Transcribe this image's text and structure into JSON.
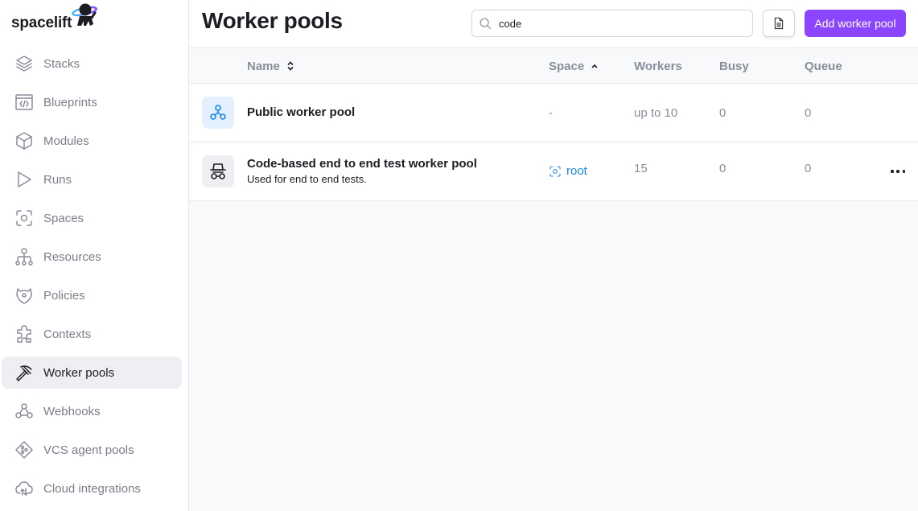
{
  "app": {
    "brand": "spacelift",
    "accent_color": "#8b45ff",
    "link_color": "#1a84e8"
  },
  "sidebar": {
    "items": [
      {
        "label": "Stacks",
        "icon": "layers-icon",
        "active": false
      },
      {
        "label": "Blueprints",
        "icon": "blueprint-icon",
        "active": false
      },
      {
        "label": "Modules",
        "icon": "cube-icon",
        "active": false
      },
      {
        "label": "Runs",
        "icon": "play-icon",
        "active": false
      },
      {
        "label": "Spaces",
        "icon": "space-icon",
        "active": false
      },
      {
        "label": "Resources",
        "icon": "hierarchy-icon",
        "active": false
      },
      {
        "label": "Policies",
        "icon": "policy-shield-icon",
        "active": false
      },
      {
        "label": "Contexts",
        "icon": "puzzle-icon",
        "active": false
      },
      {
        "label": "Worker pools",
        "icon": "pickaxe-icon",
        "active": true
      },
      {
        "label": "Webhooks",
        "icon": "webhook-icon",
        "active": false
      },
      {
        "label": "VCS agent pools",
        "icon": "vcs-agent-icon",
        "active": false
      },
      {
        "label": "Cloud integrations",
        "icon": "cloud-upload-icon",
        "active": false
      }
    ]
  },
  "header": {
    "title": "Worker pools",
    "search": {
      "value": "code",
      "placeholder": "Search..."
    },
    "docs_button_icon": "document-icon",
    "add_button_label": "Add worker pool"
  },
  "table": {
    "columns": [
      {
        "label": "Name",
        "sort": "both"
      },
      {
        "label": "Space",
        "sort": "asc"
      },
      {
        "label": "Workers"
      },
      {
        "label": "Busy"
      },
      {
        "label": "Queue"
      }
    ],
    "rows": [
      {
        "icon": "public-pool-icon",
        "name": "Public worker pool",
        "description": "",
        "space": "-",
        "workers": "up to 10",
        "busy": "0",
        "queue": "0"
      },
      {
        "icon": "private-pool-icon",
        "name": "Code-based end to end test worker pool",
        "description": "Used for end to end tests.",
        "space": "root",
        "workers": "15",
        "busy": "0",
        "queue": "0"
      }
    ]
  }
}
